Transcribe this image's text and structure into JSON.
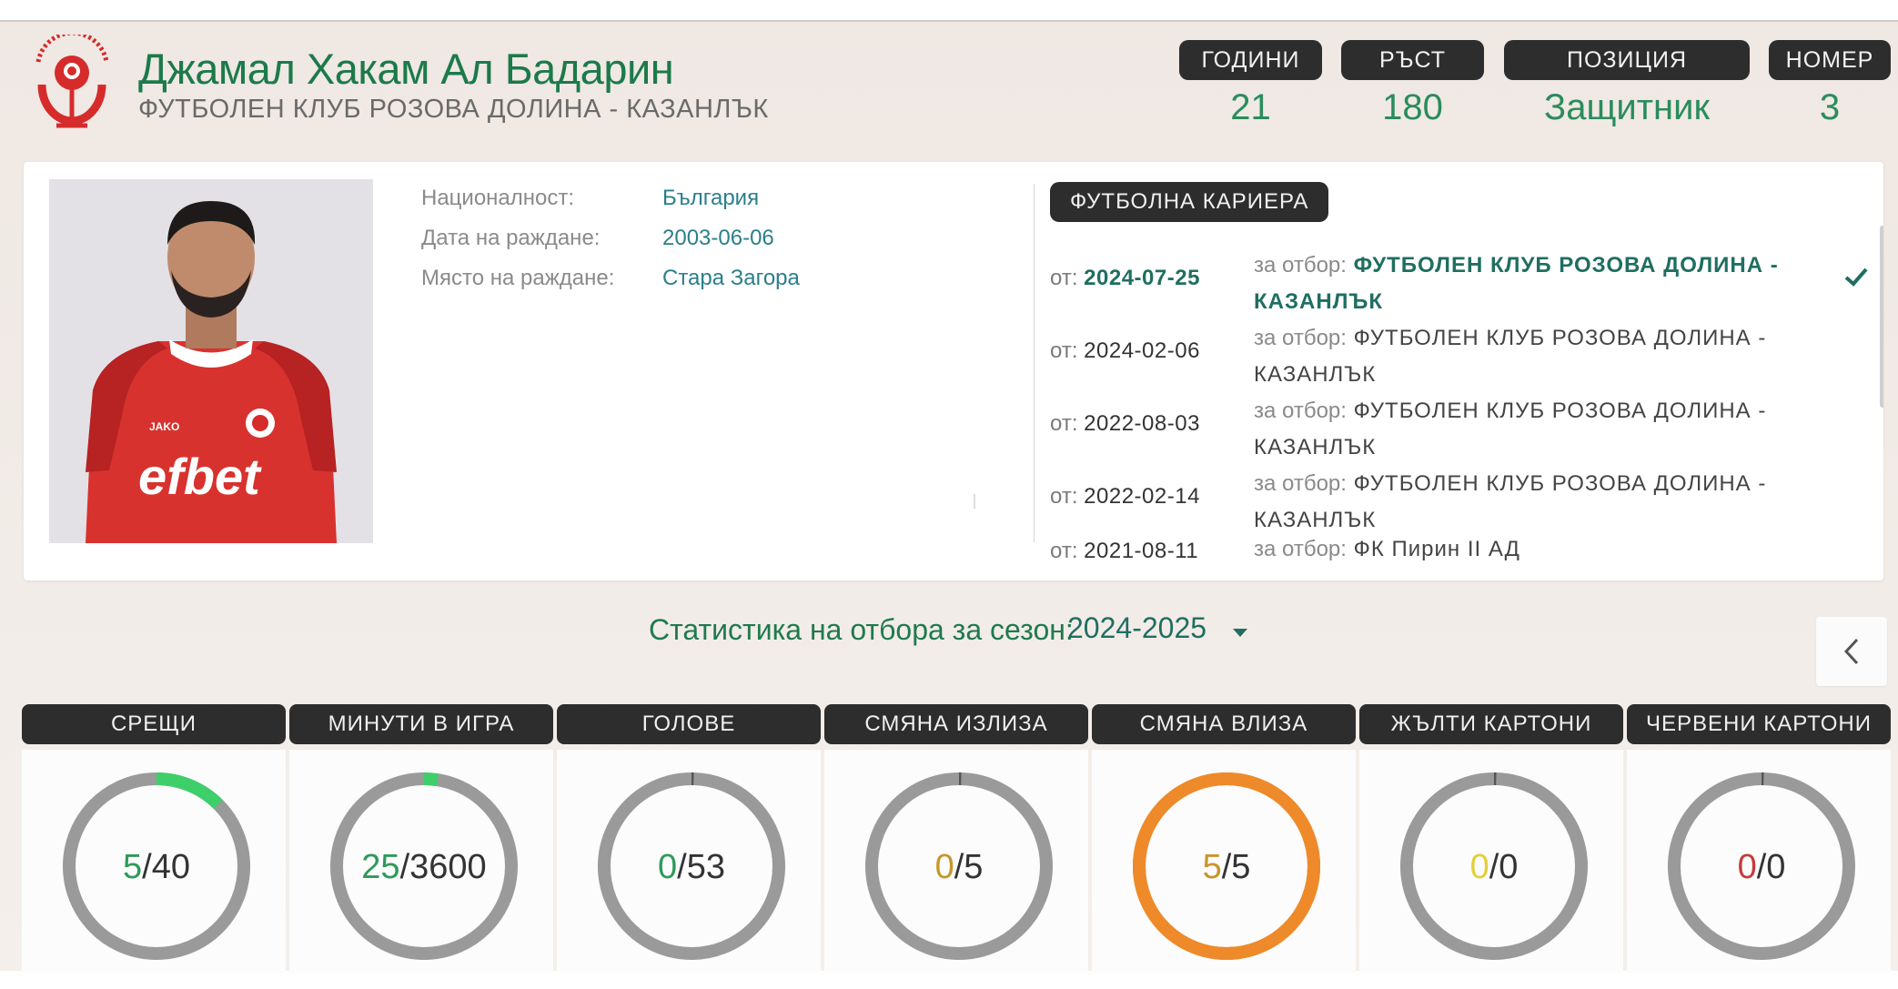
{
  "header": {
    "player_name": "Джамал Хакам Ал Бадарин",
    "club_name": "ФУТБОЛЕН КЛУБ РОЗОВА ДОЛИНА - КАЗАНЛЪК",
    "logo_icon": "club-rose-crest-icon",
    "facts": [
      {
        "label": "ГОДИНИ",
        "value": "21"
      },
      {
        "label": "РЪСТ",
        "value": "180"
      },
      {
        "label": "ПОЗИЦИЯ",
        "value": "Защитник"
      },
      {
        "label": "НОМЕР",
        "value": "3"
      }
    ]
  },
  "profile": {
    "rows": [
      {
        "key": "Националност:",
        "value": "България"
      },
      {
        "key": "Дата на раждане:",
        "value": "2003-06-06"
      },
      {
        "key": "Място на раждане:",
        "value": "Стара Загора"
      }
    ],
    "photo_sponsor": "efbet",
    "photo_kit_brand": "JAKO"
  },
  "career": {
    "title": "ФУТБОЛНА КАРИЕРА",
    "from_prefix": "от:",
    "team_prefix": "за отбор:",
    "entries": [
      {
        "date": "2024-07-25",
        "team": "ФУТБОЛЕН КЛУБ РОЗОВА ДОЛИНА - КАЗАНЛЪК",
        "current": true
      },
      {
        "date": "2024-02-06",
        "team": "ФУТБОЛЕН КЛУБ РОЗОВА ДОЛИНА - КАЗАНЛЪК",
        "current": false
      },
      {
        "date": "2022-08-03",
        "team": "ФУТБОЛЕН КЛУБ РОЗОВА ДОЛИНА - КАЗАНЛЪК",
        "current": false
      },
      {
        "date": "2022-02-14",
        "team": "ФУТБОЛЕН КЛУБ РОЗОВА ДОЛИНА - КАЗАНЛЪК",
        "current": false
      },
      {
        "date": "2021-08-11",
        "team": "ФК Пирин II АД",
        "current": false
      }
    ]
  },
  "season": {
    "label": "Статистика на отбора за сезон:",
    "selected": "2024-2025"
  },
  "stats": [
    {
      "label": "СРЕЩИ",
      "value": "5",
      "total": "40",
      "value_color": "#2f9a5a",
      "ring_color": "#9a9a9a",
      "progress_color": "#3ecf6a",
      "progress": 0.125
    },
    {
      "label": "МИНУТИ В ИГРА",
      "value": "25",
      "total": "3600",
      "value_color": "#2f9a5a",
      "ring_color": "#9a9a9a",
      "progress_color": "#3ecf6a",
      "progress": 0.025
    },
    {
      "label": "ГОЛОВЕ",
      "value": "0",
      "total": "53",
      "value_color": "#2f9a5a",
      "ring_color": "#9a9a9a",
      "progress_color": "#555555",
      "progress": 0
    },
    {
      "label": "СМЯНА ИЗЛИЗА",
      "value": "0",
      "total": "5",
      "value_color": "#c8952a",
      "ring_color": "#9a9a9a",
      "progress_color": "#555555",
      "progress": 0
    },
    {
      "label": "СМЯНА ВЛИЗА",
      "value": "5",
      "total": "5",
      "value_color": "#c8952a",
      "ring_color": "#ee8a2a",
      "progress_color": "#ee8a2a",
      "progress": 1
    },
    {
      "label": "ЖЪЛТИ КАРТОНИ",
      "value": "0",
      "total": "0",
      "value_color": "#e3cf3a",
      "ring_color": "#9a9a9a",
      "progress_color": "#555555",
      "progress": 0
    },
    {
      "label": "ЧЕРВЕНИ КАРТОНИ",
      "value": "0",
      "total": "0",
      "value_color": "#c73a3a",
      "ring_color": "#9a9a9a",
      "progress_color": "#555555",
      "progress": 0
    }
  ],
  "colors": {
    "accent_green": "#1c7a4a",
    "dark_label": "#2d2d2d",
    "club_red": "#d62b2b"
  }
}
